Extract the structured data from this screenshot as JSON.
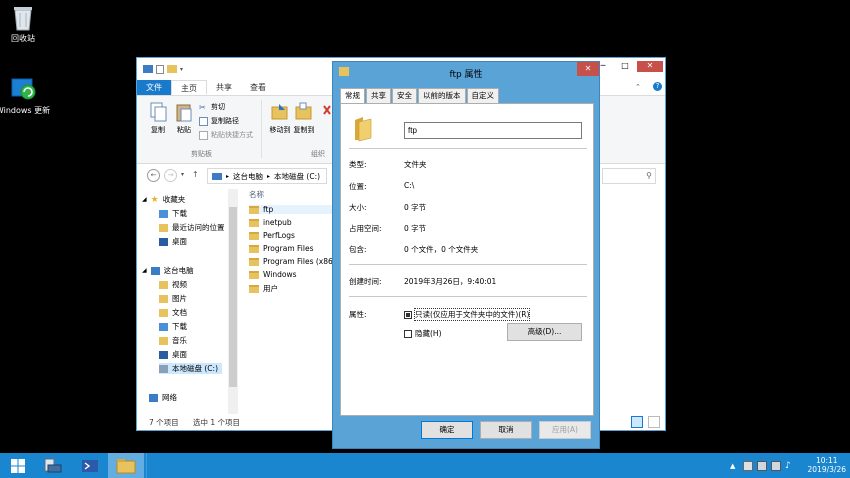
{
  "desktop": {
    "icons": [
      {
        "label": "回收站",
        "icon": "recycle-bin-icon"
      },
      {
        "label": "Windows 更新",
        "icon": "windows-update-icon"
      }
    ]
  },
  "explorer": {
    "ribbon_tabs": {
      "file": "文件",
      "home": "主页",
      "share": "共享",
      "view": "查看"
    },
    "ribbon": {
      "copy": "复制",
      "paste": "粘贴",
      "cut": "剪切",
      "copy_path": "复制路径",
      "paste_shortcut": "粘贴快捷方式",
      "clipboard_group": "剪贴板",
      "move_to": "移动到",
      "copy_to": "复制到",
      "organize_group": "组织"
    },
    "address": {
      "pc": "这台电脑",
      "drive": "本地磁盘 (C:)"
    },
    "nav_pane": {
      "favorites": "收藏夹",
      "favorites_items": [
        "下载",
        "最近访问的位置",
        "桌面"
      ],
      "this_pc": "这台电脑",
      "pc_items": [
        "视频",
        "图片",
        "文档",
        "下载",
        "音乐",
        "桌面",
        "本地磁盘 (C:)"
      ],
      "network": "网络"
    },
    "column_header": "名称",
    "files": [
      "ftp",
      "inetpub",
      "PerfLogs",
      "Program Files",
      "Program Files (x86",
      "Windows",
      "用户"
    ],
    "status": {
      "count": "7 个项目",
      "selected": "选中 1 个项目"
    }
  },
  "props": {
    "title": "ftp 属性",
    "tabs": [
      "常规",
      "共享",
      "安全",
      "以前的版本",
      "自定义"
    ],
    "name_value": "ftp",
    "rows": [
      {
        "label": "类型:",
        "value": "文件夹"
      },
      {
        "label": "位置:",
        "value": "C:\\"
      },
      {
        "label": "大小:",
        "value": "0 字节"
      },
      {
        "label": "占用空间:",
        "value": "0 字节"
      },
      {
        "label": "包含:",
        "value": "0 个文件，0 个文件夹"
      }
    ],
    "created_label": "创建时间:",
    "created_value": "2019年3月26日，9:40:01",
    "attributes_label": "属性:",
    "readonly_label": "只读(仅应用于文件夹中的文件)(R)",
    "hidden_label": "隐藏(H)",
    "advanced_button": "高级(D)...",
    "ok_button": "确定",
    "cancel_button": "取消",
    "apply_button": "应用(A)"
  },
  "taskbar": {
    "time": "10:11",
    "date": "2019/3/26"
  },
  "colors": {
    "accent": "#1979ca",
    "taskbar": "#1a86cf",
    "dialog_frame": "#5aa3d6",
    "close_button": "#c7504a"
  }
}
